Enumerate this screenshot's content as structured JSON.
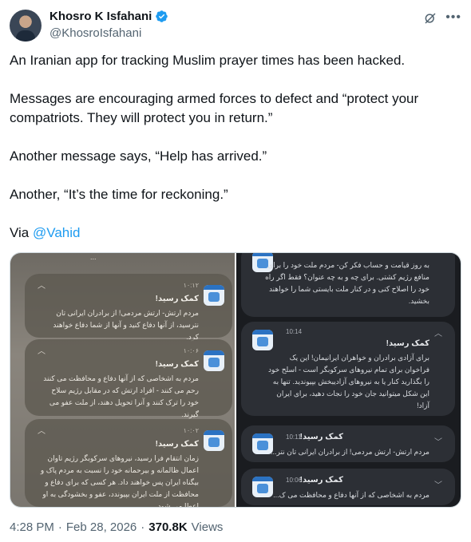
{
  "author": {
    "display_name": "Khosro K Isfahani",
    "handle": "@KhosroIsfahani"
  },
  "tweet": {
    "paragraph_1": "An Iranian app for tracking Muslim prayer times has been hacked.",
    "paragraph_2": "Messages are encouraging armed forces to defect and “protect your compatriots. They will protect you in return.”",
    "paragraph_3": "Another message says, “Help has arrived.”",
    "paragraph_4": "Another, “It’s the time for reckoning.”",
    "via_label": "Via",
    "via_mention": "@Vahid"
  },
  "left_notifications": {
    "top_fragment": "...",
    "cards": [
      {
        "time": "۱۰:۱۲",
        "title": "کمک رسید!",
        "body": "مردم ارتش- ارتش مردمی! از برادران ایرانی تان نترسید، از آنها دفاع کنید و آنها از شما دفاع خواهند کرد."
      },
      {
        "time": "۱۰:۰۶",
        "title": "کمک رسید!",
        "body": "مردم به اشخاصی که از آنها دفاع و محافظت می کنند رحم می کنند - افراد ارتش که در مقابل رژیم سلاح خود را ترک کنند و آنرا تحویل دهند، از ملت عفو می گیرند."
      },
      {
        "time": "۱۰:۰۲",
        "title": "کمک رسید!",
        "body": "زمان انتقام فرا رسید، نیروهای سرکوبگر رژیم تاوان اعمال ظالمانه و بیرحمانه خود را نسبت به مردم پاک و بیگناه ایران پس خواهند داد. هر کسی که برای دفاع و محافظت از ملت ایران بپیوندد، عفو و بخشودگی به او اعطا می شود."
      }
    ]
  },
  "right_notifications": {
    "top_card": {
      "title": "...",
      "body": "به روز قیامت و حساب فکر کن- مردم ملت خود را برای منافع رژیم کشتی. برای چه و به چه عنوان؟ فقط اگر راه خود را اصلاح کنی و در کنار ملت بایستی شما را خواهند بخشید."
    },
    "expanded_card": {
      "time": "10:14",
      "title": "کمک رسید!",
      "body": "برای آزادی برادران و خواهران ایرانیمان! این یک فراخوان برای تمام نیروهای سرکوبگر است - اسلح خود را بگذارید کنار یا به نیروهای آزادیبخش بپیوندید. تنها به این شکل میتوانید جان خود را نجات دهید، برای ایران آزاد!"
    },
    "collapsed_cards": [
      {
        "time": "10:11",
        "title": "کمک رسید!",
        "body": "مردم ارتش- ارتش مردمی! از برادران ایرانی تان نتر..."
      },
      {
        "time": "10:06",
        "title": "کمک رسید!",
        "body": "مردم به اشخاصی که از آنها دفاع و محافظت می ک..."
      }
    ]
  },
  "footer": {
    "time": "4:28 PM",
    "separator": "·",
    "date": "Feb 28, 2026",
    "views_count": "370.8K",
    "views_label": "Views"
  },
  "colors": {
    "link": "#1d9bf0",
    "verified": "#1d9bf0",
    "secondary_text": "#536471"
  }
}
